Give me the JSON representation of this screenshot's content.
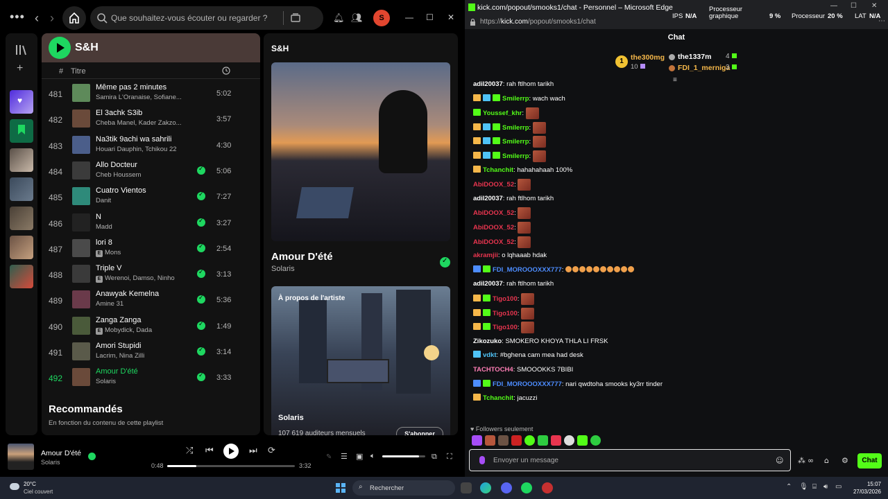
{
  "spotify": {
    "search_placeholder": "Que souhaitez-vous écouter ou regarder ?",
    "avatar_letter": "S",
    "playlist": {
      "title": "S&H",
      "col_number": "#",
      "col_title": "Titre",
      "tracks": [
        {
          "n": "481",
          "title": "Même pas 2 minutes",
          "artist": "Samira L'Oranaise, Sofiane...",
          "duration": "5:02",
          "explicit": false,
          "liked": false
        },
        {
          "n": "482",
          "title": "El 3achk S3ib",
          "artist": "Cheba Manel, Kader Zakzo...",
          "duration": "3:57",
          "explicit": false,
          "liked": false
        },
        {
          "n": "483",
          "title": "Na3tik 9achi wa sahrili",
          "artist": "Houari Dauphin, Tchikou 22",
          "duration": "4:30",
          "explicit": false,
          "liked": false
        },
        {
          "n": "484",
          "title": "Allo Docteur",
          "artist": "Cheb Houssem",
          "duration": "5:06",
          "explicit": false,
          "liked": true
        },
        {
          "n": "485",
          "title": "Cuatro Vientos",
          "artist": "Danit",
          "duration": "7:27",
          "explicit": false,
          "liked": true
        },
        {
          "n": "486",
          "title": "N",
          "artist": "Madd",
          "duration": "3:27",
          "explicit": false,
          "liked": true
        },
        {
          "n": "487",
          "title": "lori 8",
          "artist": "Mons",
          "duration": "2:54",
          "explicit": true,
          "liked": true
        },
        {
          "n": "488",
          "title": "Triple V",
          "artist": "Werenoi, Damso, Ninho",
          "duration": "3:13",
          "explicit": true,
          "liked": true
        },
        {
          "n": "489",
          "title": "Anawyak Kemelna",
          "artist": "Amine 31",
          "duration": "5:36",
          "explicit": false,
          "liked": true
        },
        {
          "n": "490",
          "title": "Zanga Zanga",
          "artist": "Mobydick, Dada",
          "duration": "1:49",
          "explicit": true,
          "liked": true
        },
        {
          "n": "491",
          "title": "Amori Stupidi",
          "artist": "Lacrim, Nina Zilli",
          "duration": "3:14",
          "explicit": false,
          "liked": true
        },
        {
          "n": "492",
          "title": "Amour D'été",
          "artist": "Solaris",
          "duration": "3:33",
          "explicit": false,
          "liked": true
        }
      ],
      "recommended_title": "Recommandés",
      "recommended_sub": "En fonction du contenu de cette playlist"
    },
    "right_panel": {
      "title": "S&H",
      "song": "Amour D'été",
      "artist": "Solaris",
      "about_label": "À propos de l'artiste",
      "about_artist": "Solaris",
      "monthly_listeners": "107 619 auditeurs mensuels",
      "subscribe": "S'abonner"
    },
    "player": {
      "title": "Amour D'été",
      "artist": "Solaris",
      "elapsed": "0:48",
      "total": "3:32",
      "progress": 0.23,
      "volume": 0.85
    }
  },
  "edge": {
    "title": "kick.com/popout/smooks1/chat - Personnel – Microsoft Edge",
    "url_prefix": "https://",
    "url_host": "kick.com",
    "url_path": "/popout/smooks1/chat",
    "overlay": {
      "ips_label": "IPS",
      "ips_value": "N/A",
      "gpu_label": "Processeur graphique",
      "gpu_value": "9 %",
      "cpu_label": "Processeur",
      "cpu_value": "20 %",
      "lat_label": "LAT",
      "lat_value": "N/A"
    },
    "chat": {
      "header": "Chat",
      "leaderboard": {
        "rank": "1",
        "first_name": "the300mg",
        "first_count": "10",
        "second_name": "the1337m",
        "second_count": "4",
        "third_name": "FDI_1_merniga",
        "third_count": "3"
      },
      "messages": [
        {
          "user": "adil20037",
          "color": "#ffffff",
          "text": "rah ftlhom tarikh",
          "emotes": 0,
          "emojis": 0,
          "badges": []
        },
        {
          "user": "Smilerrp",
          "color": "#53fc18",
          "text": "wach wach",
          "emotes": 0,
          "emojis": 0,
          "badges": [
            "#f5b74a",
            "#4fc3f7",
            "#53fc18"
          ]
        },
        {
          "user": "Youssef_khr",
          "color": "#53fc18",
          "text": "",
          "emotes": 1,
          "emojis": 0,
          "badges": [
            "#53fc18"
          ]
        },
        {
          "user": "Smilerrp",
          "color": "#53fc18",
          "text": "",
          "emotes": 1,
          "emojis": 0,
          "badges": [
            "#f5b74a",
            "#4fc3f7",
            "#53fc18"
          ]
        },
        {
          "user": "Smilerrp",
          "color": "#53fc18",
          "text": "",
          "emotes": 1,
          "emojis": 0,
          "badges": [
            "#f5b74a",
            "#4fc3f7",
            "#53fc18"
          ]
        },
        {
          "user": "Smilerrp",
          "color": "#53fc18",
          "text": "",
          "emotes": 1,
          "emojis": 0,
          "badges": [
            "#f5b74a",
            "#4fc3f7",
            "#53fc18"
          ]
        },
        {
          "user": "Tchanchit",
          "color": "#53fc18",
          "text": "hahahahaah 100%",
          "emotes": 0,
          "emojis": 0,
          "badges": [
            "#f5b74a"
          ]
        },
        {
          "user": "AbiDOOX_52",
          "color": "#e8354f",
          "text": "",
          "emotes": 1,
          "emojis": 0,
          "badges": []
        },
        {
          "user": "adil20037",
          "color": "#ffffff",
          "text": "rah ftlhom tarikh",
          "emotes": 0,
          "emojis": 0,
          "badges": []
        },
        {
          "user": "AbiDOOX_52",
          "color": "#e8354f",
          "text": "",
          "emotes": 1,
          "emojis": 0,
          "badges": []
        },
        {
          "user": "AbiDOOX_52",
          "color": "#e8354f",
          "text": "",
          "emotes": 1,
          "emojis": 0,
          "badges": []
        },
        {
          "user": "AbiDOOX_52",
          "color": "#e8354f",
          "text": "",
          "emotes": 1,
          "emojis": 0,
          "badges": []
        },
        {
          "user": "akramjii",
          "color": "#e8354f",
          "text": "o lqhaaab hdak",
          "emotes": 0,
          "emojis": 0,
          "badges": []
        },
        {
          "user": "FDI_MOROOOXXX777",
          "color": "#4d8dff",
          "text": "",
          "emotes": 0,
          "emojis": 10,
          "badges": [
            "#4d8dff",
            "#53fc18"
          ]
        },
        {
          "user": "adil20037",
          "color": "#ffffff",
          "text": "rah ftlhom tarikh",
          "emotes": 0,
          "emojis": 0,
          "badges": []
        },
        {
          "user": "Tigo100",
          "color": "#e8354f",
          "text": "",
          "emotes": 1,
          "emojis": 0,
          "badges": [
            "#f5b74a",
            "#53fc18"
          ]
        },
        {
          "user": "Tigo100",
          "color": "#e8354f",
          "text": "",
          "emotes": 1,
          "emojis": 0,
          "badges": [
            "#f5b74a",
            "#53fc18"
          ]
        },
        {
          "user": "Tigo100",
          "color": "#e8354f",
          "text": "",
          "emotes": 1,
          "emojis": 0,
          "badges": [
            "#f5b74a",
            "#53fc18"
          ]
        },
        {
          "user": "Zikozuko",
          "color": "#ffffff",
          "text": "SMOKERO KHOYA THLA LI FRSK",
          "emotes": 0,
          "emojis": 0,
          "badges": []
        },
        {
          "user": "vdkt",
          "color": "#4fc3f7",
          "text": "#bghena cam mea had desk",
          "emotes": 0,
          "emojis": 0,
          "badges": [
            "#4fc3f7"
          ]
        },
        {
          "user": "TACHTOCH4",
          "color": "#ff7eb6",
          "text": "SMOOOKKS 7BIBI",
          "emotes": 0,
          "emojis": 0,
          "badges": []
        },
        {
          "user": "FDI_MOROOOXXX777",
          "color": "#4d8dff",
          "text": "nari qwdtoha smooks ky3rr tinder",
          "emotes": 0,
          "emojis": 0,
          "badges": [
            "#4d8dff",
            "#53fc18"
          ]
        },
        {
          "user": "Tchanchit",
          "color": "#53fc18",
          "text": "jacuzzi",
          "emotes": 0,
          "emojis": 0,
          "badges": [
            "#f5b74a"
          ]
        }
      ],
      "followers_only": "Followers seulement",
      "input_placeholder": "Envoyer un message",
      "send_label": "Chat"
    }
  },
  "taskbar": {
    "temperature": "20°C",
    "weather": "Ciel couvert",
    "search_placeholder": "Rechercher",
    "time": "15:07",
    "date": "27/03/2026"
  }
}
